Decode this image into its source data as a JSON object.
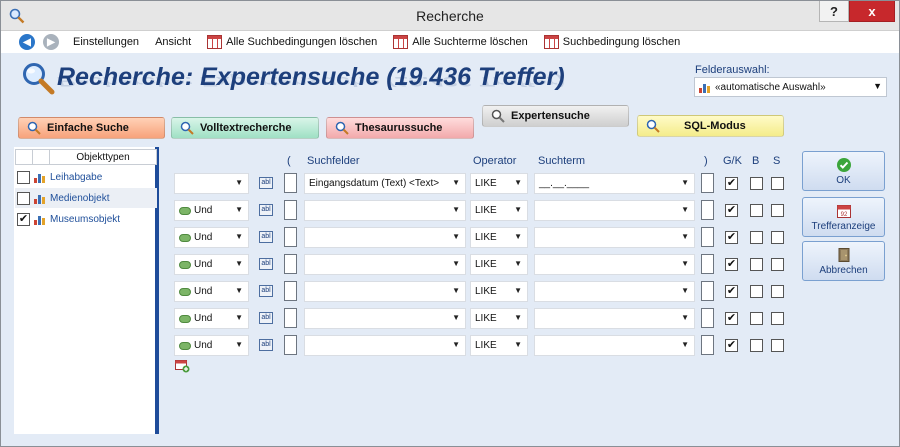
{
  "window": {
    "title": "Recherche",
    "help_label": "?",
    "close_label": "x"
  },
  "toolbar": {
    "back_icon": "back-arrow-icon",
    "forward_icon": "forward-arrow-icon",
    "items": [
      {
        "label": "Einstellungen"
      },
      {
        "label": "Ansicht"
      },
      {
        "label": "Alle Suchbedingungen löschen",
        "icon": "grid-delete-icon"
      },
      {
        "label": "Alle Suchterme löschen",
        "icon": "grid-delete-icon"
      },
      {
        "label": "Suchbedingung löschen",
        "icon": "grid-delete-icon"
      }
    ]
  },
  "header": {
    "title": "Recherche: Expertensuche (19.436 Treffer)",
    "felder_label": "Felderauswahl:",
    "felder_value": "«automatische Auswahl»"
  },
  "tabs": [
    {
      "label": "Einfache Suche",
      "color": "#f7a27b"
    },
    {
      "label": "Volltextrecherche",
      "color": "#9fe0c4"
    },
    {
      "label": "Thesaurussuche",
      "color": "#f2a9ab"
    },
    {
      "label": "Expertensuche",
      "color": "#cfcfcf",
      "active": true
    },
    {
      "label": "SQL-Modus",
      "color": "#f4ec8a"
    }
  ],
  "object_types": {
    "header": "Objekttypen",
    "items": [
      {
        "label": "Leihabgabe",
        "checked": false
      },
      {
        "label": "Medienobjekt",
        "checked": false
      },
      {
        "label": "Museumsobjekt",
        "checked": true
      }
    ]
  },
  "grid": {
    "headers": {
      "open_paren": "(",
      "suchfelder": "Suchfelder",
      "operator": "Operator",
      "suchterm": "Suchterm",
      "close_paren": ")",
      "gk": "G/K",
      "b": "B",
      "s": "S"
    },
    "rows": [
      {
        "connector": "",
        "field": "Eingangsdatum (Text) <Text>",
        "operator": "LIKE",
        "term": "__.__.____",
        "gk": true,
        "b": false,
        "s": false
      },
      {
        "connector": "Und",
        "field": "",
        "operator": "LIKE",
        "term": "",
        "gk": true,
        "b": false,
        "s": false
      },
      {
        "connector": "Und",
        "field": "",
        "operator": "LIKE",
        "term": "",
        "gk": true,
        "b": false,
        "s": false
      },
      {
        "connector": "Und",
        "field": "",
        "operator": "LIKE",
        "term": "",
        "gk": true,
        "b": false,
        "s": false
      },
      {
        "connector": "Und",
        "field": "",
        "operator": "LIKE",
        "term": "",
        "gk": true,
        "b": false,
        "s": false
      },
      {
        "connector": "Und",
        "field": "",
        "operator": "LIKE",
        "term": "",
        "gk": true,
        "b": false,
        "s": false
      },
      {
        "connector": "Und",
        "field": "",
        "operator": "LIKE",
        "term": "",
        "gk": true,
        "b": false,
        "s": false
      }
    ],
    "abl_label": "abl"
  },
  "actions": {
    "ok": "OK",
    "trefferanzeige": "Trefferanzeige",
    "abbrechen": "Abbrechen"
  },
  "colors": {
    "accent": "#1d3f7c",
    "panel_bg": "#e3ebf6",
    "separator": "#1e4c9a",
    "close_button": "#c7282c"
  }
}
